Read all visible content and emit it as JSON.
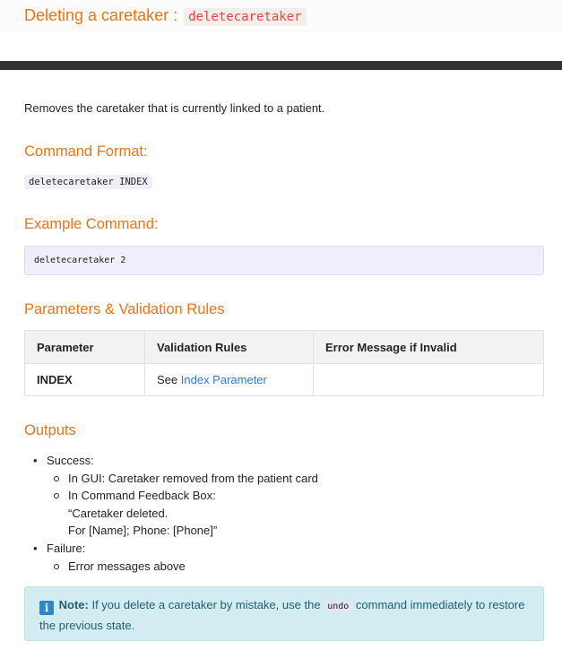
{
  "header": {
    "title": "Deleting a caretaker :",
    "command": "deletecaretaker"
  },
  "intro": "Removes the caretaker that is currently linked to a patient.",
  "command_format": {
    "heading": "Command Format:",
    "code": "deletecaretaker INDEX"
  },
  "example": {
    "heading": "Example Command:",
    "code": "deletecaretaker 2"
  },
  "parameters": {
    "heading": "Parameters & Validation Rules",
    "columns": [
      "Parameter",
      "Validation Rules",
      "Error Message if Invalid"
    ],
    "rows": [
      {
        "parameter": "INDEX",
        "rule_prefix": "See",
        "rule_link": "Index Parameter",
        "error": ""
      }
    ]
  },
  "outputs": {
    "heading": "Outputs",
    "success_label": "Success:",
    "success_items": [
      "In GUI: Caretaker removed from the patient card",
      "In Command Feedback Box:"
    ],
    "feedback_lines": [
      "“Caretaker deleted.",
      "For [Name]; Phone: [Phone]”"
    ],
    "failure_label": "Failure:",
    "failure_items": [
      "Error messages above"
    ]
  },
  "note": {
    "icon": "info-icon",
    "icon_glyph": "i",
    "label": "Note:",
    "text_before": "If you delete a caretaker by mistake, use the",
    "code": "undo",
    "text_after": "command immediately to restore the previous state."
  },
  "colors": {
    "heading": "#e8751a",
    "link": "#2f7bd1",
    "note_bg": "#d3ecf1",
    "dark_bar": "#333333"
  }
}
